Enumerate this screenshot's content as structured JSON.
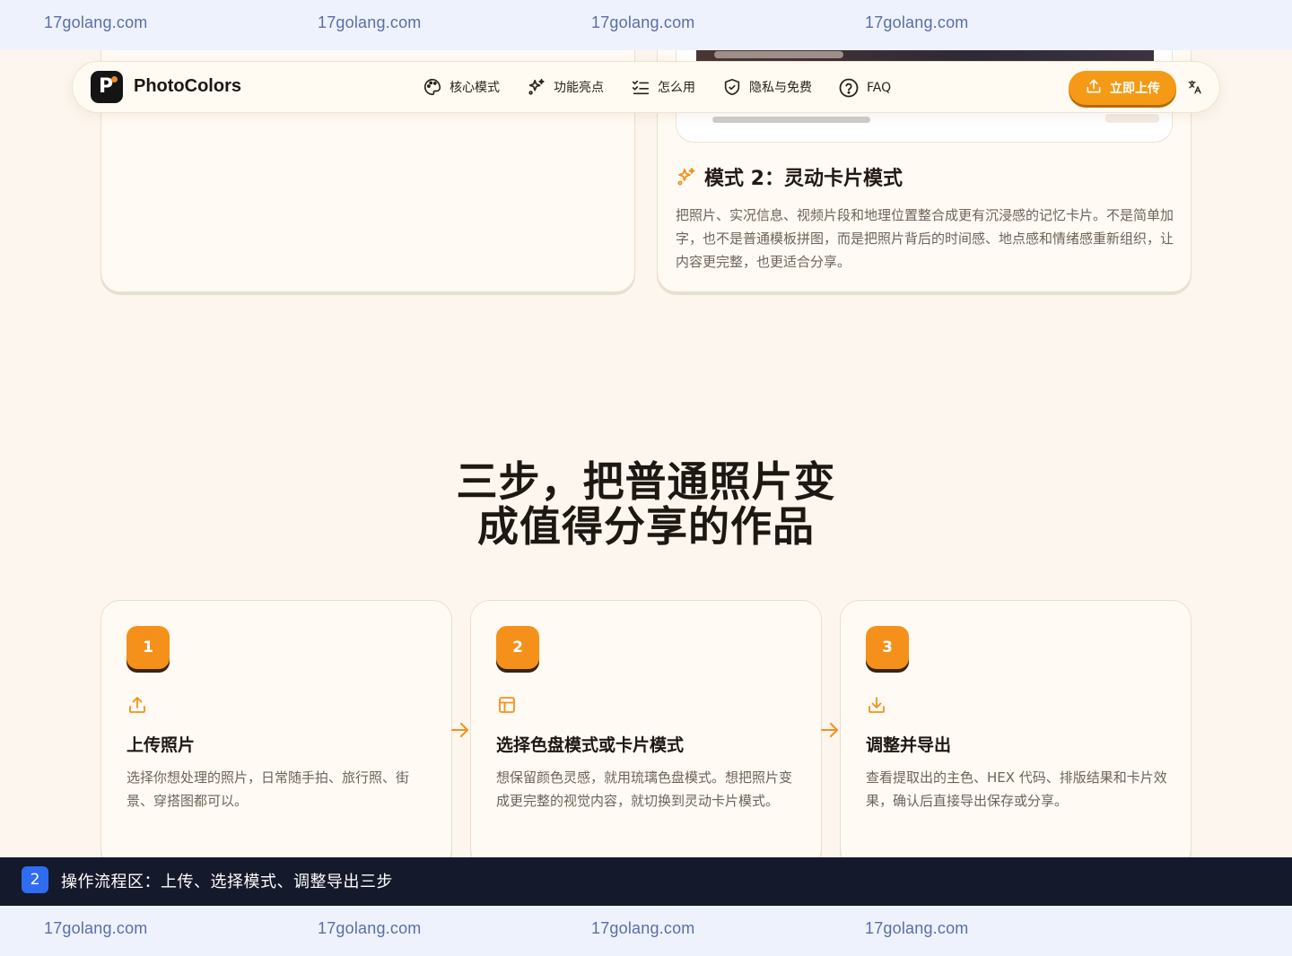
{
  "watermark": "17golang.com",
  "nav": {
    "brand": "PhotoColors",
    "items": [
      {
        "label": "核心模式",
        "icon": "palette-icon"
      },
      {
        "label": "功能亮点",
        "icon": "sparkles-icon"
      },
      {
        "label": "怎么用",
        "icon": "checklist-icon"
      },
      {
        "label": "隐私与免费",
        "icon": "shield-check-icon"
      },
      {
        "label": "FAQ",
        "icon": "help-circle-icon"
      }
    ],
    "upload_label": "立即上传",
    "translate_icon": "translate-icon"
  },
  "mode_card": {
    "title": "模式 2：灵动卡片模式",
    "description": "把照片、实况信息、视频片段和地理位置整合成更有沉浸感的记忆卡片。不是简单加字，也不是普通模板拼图，而是把照片背后的时间感、地点感和情绪感重新组织，让内容更完整，也更适合分享。"
  },
  "steps_section": {
    "heading_line1": "三步，把普通照片变",
    "heading_line2": "成值得分享的作品",
    "steps": [
      {
        "number": "1",
        "icon": "upload-icon",
        "title": "上传照片",
        "description": "选择你想处理的照片，日常随手拍、旅行照、街景、穿搭图都可以。"
      },
      {
        "number": "2",
        "icon": "layout-icon",
        "title": "选择色盘模式或卡片模式",
        "description": "想保留颜色灵感，就用琉璃色盘模式。想把照片变成更完整的视觉内容，就切换到灵动卡片模式。"
      },
      {
        "number": "3",
        "icon": "download-icon",
        "title": "调整并导出",
        "description": "查看提取出的主色、HEX 代码、排版结果和卡片效果，确认后直接导出保存或分享。"
      }
    ]
  },
  "caption": {
    "badge": "2",
    "text": "操作流程区：上传、选择模式、调整导出三步"
  },
  "colors": {
    "accent": "#f5901a",
    "background": "#fdf6ee",
    "caption_bg": "#14192b",
    "badge_blue": "#2f6cf0"
  }
}
